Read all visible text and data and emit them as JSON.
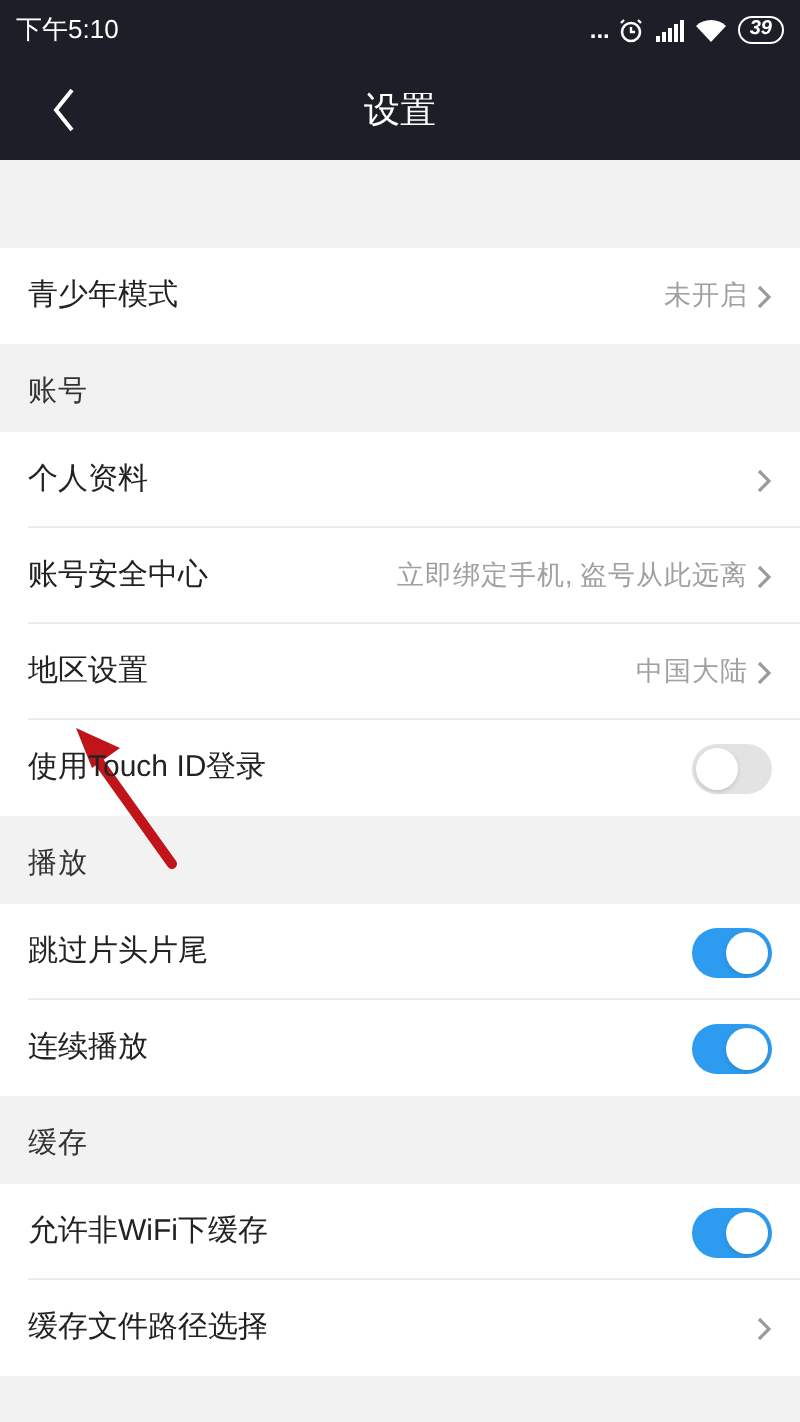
{
  "status_bar": {
    "time": "下午5:10",
    "dots": "...",
    "battery": "39"
  },
  "header": {
    "title": "设置"
  },
  "sections": [
    {
      "items": [
        {
          "kind": "link",
          "label": "青少年模式",
          "value": "未开启"
        }
      ]
    },
    {
      "title": "账号",
      "items": [
        {
          "kind": "link",
          "label": "个人资料"
        },
        {
          "kind": "link",
          "label": "账号安全中心",
          "value": "立即绑定手机, 盗号从此远离"
        },
        {
          "kind": "link",
          "label": "地区设置",
          "value": "中国大陆"
        },
        {
          "kind": "toggle",
          "label": "使用Touch ID登录",
          "on": false
        }
      ]
    },
    {
      "title": "播放",
      "items": [
        {
          "kind": "toggle",
          "label": "跳过片头片尾",
          "on": true
        },
        {
          "kind": "toggle",
          "label": "连续播放",
          "on": true
        }
      ]
    },
    {
      "title": "缓存",
      "items": [
        {
          "kind": "toggle",
          "label": "允许非WiFi下缓存",
          "on": true
        },
        {
          "kind": "link",
          "label": "缓存文件路径选择"
        }
      ]
    }
  ]
}
